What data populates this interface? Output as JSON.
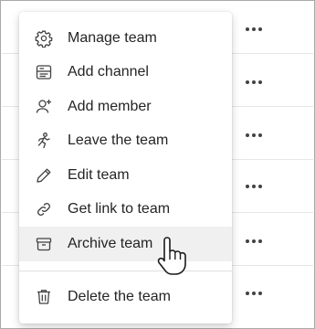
{
  "menu": {
    "items": [
      {
        "label": "Manage team",
        "icon": "gear-icon"
      },
      {
        "label": "Add channel",
        "icon": "channel-icon"
      },
      {
        "label": "Add member",
        "icon": "add-person-icon"
      },
      {
        "label": "Leave the team",
        "icon": "leave-icon"
      },
      {
        "label": "Edit team",
        "icon": "pencil-icon"
      },
      {
        "label": "Get link to team",
        "icon": "link-icon"
      },
      {
        "label": "Archive team",
        "icon": "archive-icon",
        "hovered": true
      }
    ],
    "danger_item": {
      "label": "Delete the team",
      "icon": "trash-icon"
    }
  },
  "background": {
    "rows_more_icon": "more-options-icon"
  },
  "colors": {
    "text": "#242424",
    "icon": "#424242",
    "hover": "#f0f0f0",
    "frame_border": "#a9a9a9"
  },
  "cursor": "hand-pointer-icon"
}
